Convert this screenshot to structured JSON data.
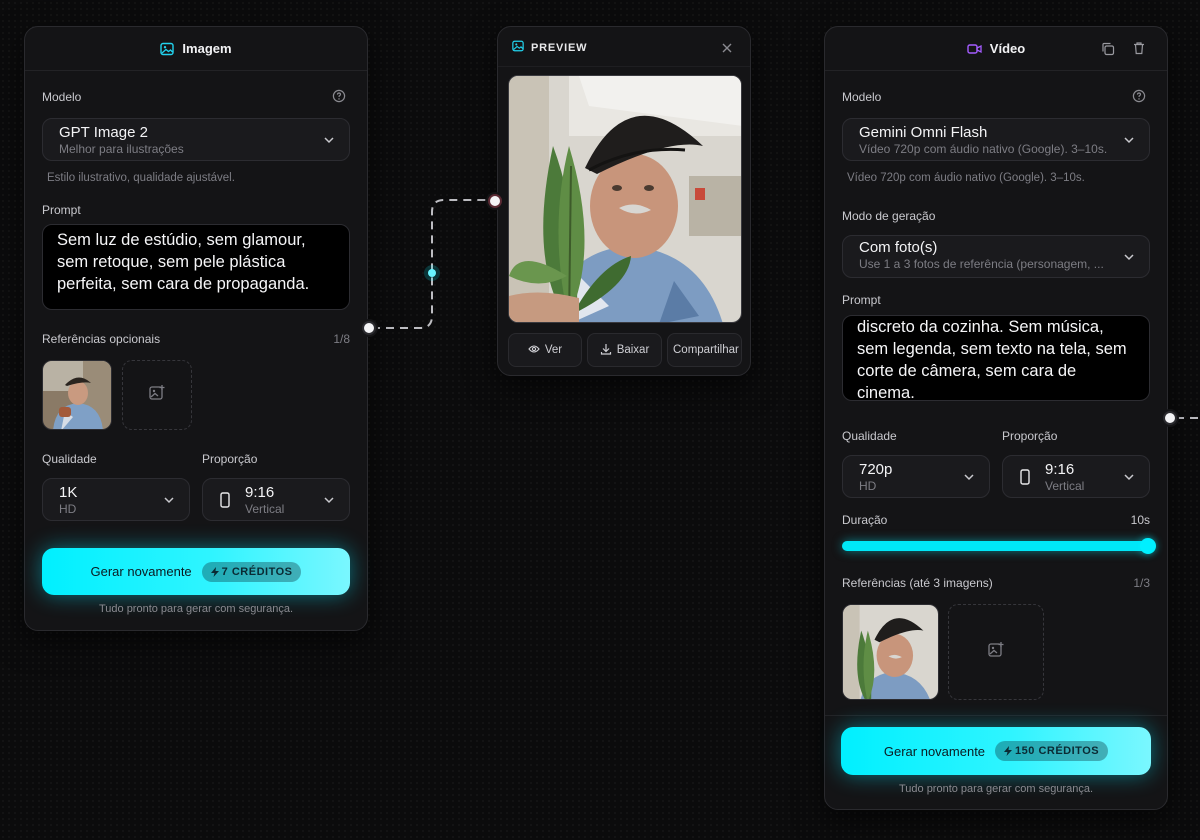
{
  "image_card": {
    "title": "Imagem",
    "model_label": "Modelo",
    "model_name": "GPT Image 2",
    "model_sub": "Melhor para ilustrações",
    "model_note": "Estilo ilustrativo, qualidade ajustável.",
    "prompt_label": "Prompt",
    "prompt_text": "Sem luz de estúdio, sem glamour, sem retoque, sem pele plástica perfeita, sem cara de propaganda.",
    "refs_label": "Referências opcionais",
    "refs_count": "1/8",
    "quality_label": "Qualidade",
    "quality_value": "1K",
    "quality_sub": "HD",
    "ratio_label": "Proporção",
    "ratio_value": "9:16",
    "ratio_sub": "Vertical",
    "generate_label": "Gerar novamente",
    "credits": "7 CRÉDITOS",
    "footnote": "Tudo pronto para gerar com segurança."
  },
  "preview_card": {
    "title": "PREVIEW",
    "view_label": "Ver",
    "download_label": "Baixar",
    "share_label": "Compartilhar"
  },
  "video_card": {
    "title": "Vídeo",
    "model_label": "Modelo",
    "model_name": "Gemini Omni Flash",
    "model_sub": "Vídeo 720p com áudio nativo (Google). 3–10s.",
    "model_note": "Vídeo 720p com áudio nativo (Google). 3–10s.",
    "mode_label": "Modo de geração",
    "mode_value": "Com foto(s)",
    "mode_sub": "Use 1 a 3 fotos de referência (personagem, ...",
    "prompt_label": "Prompt",
    "prompt_text": "discreto da cozinha. Sem música, sem legenda, sem texto na tela, sem corte de câmera, sem cara de cinema.",
    "quality_label": "Qualidade",
    "quality_value": "720p",
    "quality_sub": "HD",
    "ratio_label": "Proporção",
    "ratio_value": "9:16",
    "ratio_sub": "Vertical",
    "duration_label": "Duração",
    "duration_value": "10s",
    "duration_fraction": 1.0,
    "refs_label": "Referências (até 3 imagens)",
    "refs_count": "1/3",
    "generate_label": "Gerar novamente",
    "credits": "150 CRÉDITOS",
    "footnote": "Tudo pronto para gerar com segurança."
  },
  "colors": {
    "accent": "#00f0ff",
    "video_icon": "#a45cff",
    "image_icon": "#22d3ee"
  }
}
